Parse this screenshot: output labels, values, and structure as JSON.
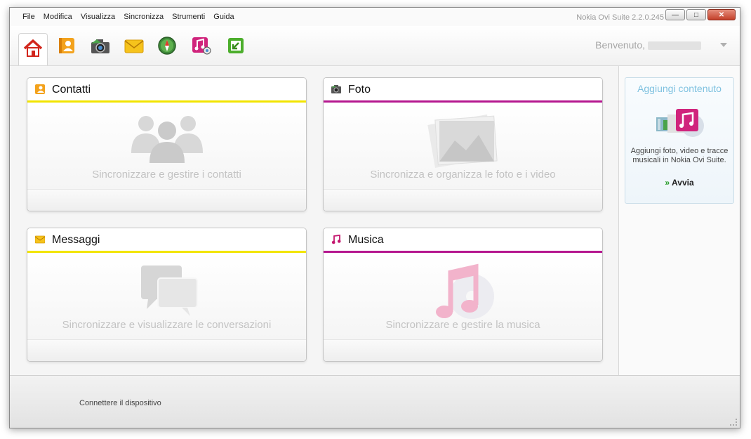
{
  "menubar": {
    "items": [
      "File",
      "Modifica",
      "Visualizza",
      "Sincronizza",
      "Strumenti",
      "Guida"
    ],
    "app_title": "Nokia Ovi Suite 2.2.0.245"
  },
  "toolbar": {
    "icons": [
      "home-icon",
      "contacts-icon",
      "photos-icon",
      "messages-icon",
      "maps-icon",
      "music-icon",
      "sync-icon"
    ],
    "welcome": "Benvenuto,"
  },
  "panels": {
    "contatti": {
      "title": "Contatti",
      "desc": "Sincronizzare e gestire i contatti",
      "accent": "#f2e400"
    },
    "foto": {
      "title": "Foto",
      "desc": "Sincronizza e organizza le foto e i video",
      "accent": "#b5178f"
    },
    "messaggi": {
      "title": "Messaggi",
      "desc": "Sincronizzare e visualizzare le conversazioni",
      "accent": "#f2e400"
    },
    "musica": {
      "title": "Musica",
      "desc": "Sincronizzare e gestire la musica",
      "accent": "#b5178f"
    }
  },
  "sidebar": {
    "title": "Aggiungi contenuto",
    "desc": "Aggiungi foto, video e tracce musicali in Nokia Ovi Suite.",
    "action": "Avvia"
  },
  "status": {
    "text": "Connettere il dispositivo"
  }
}
